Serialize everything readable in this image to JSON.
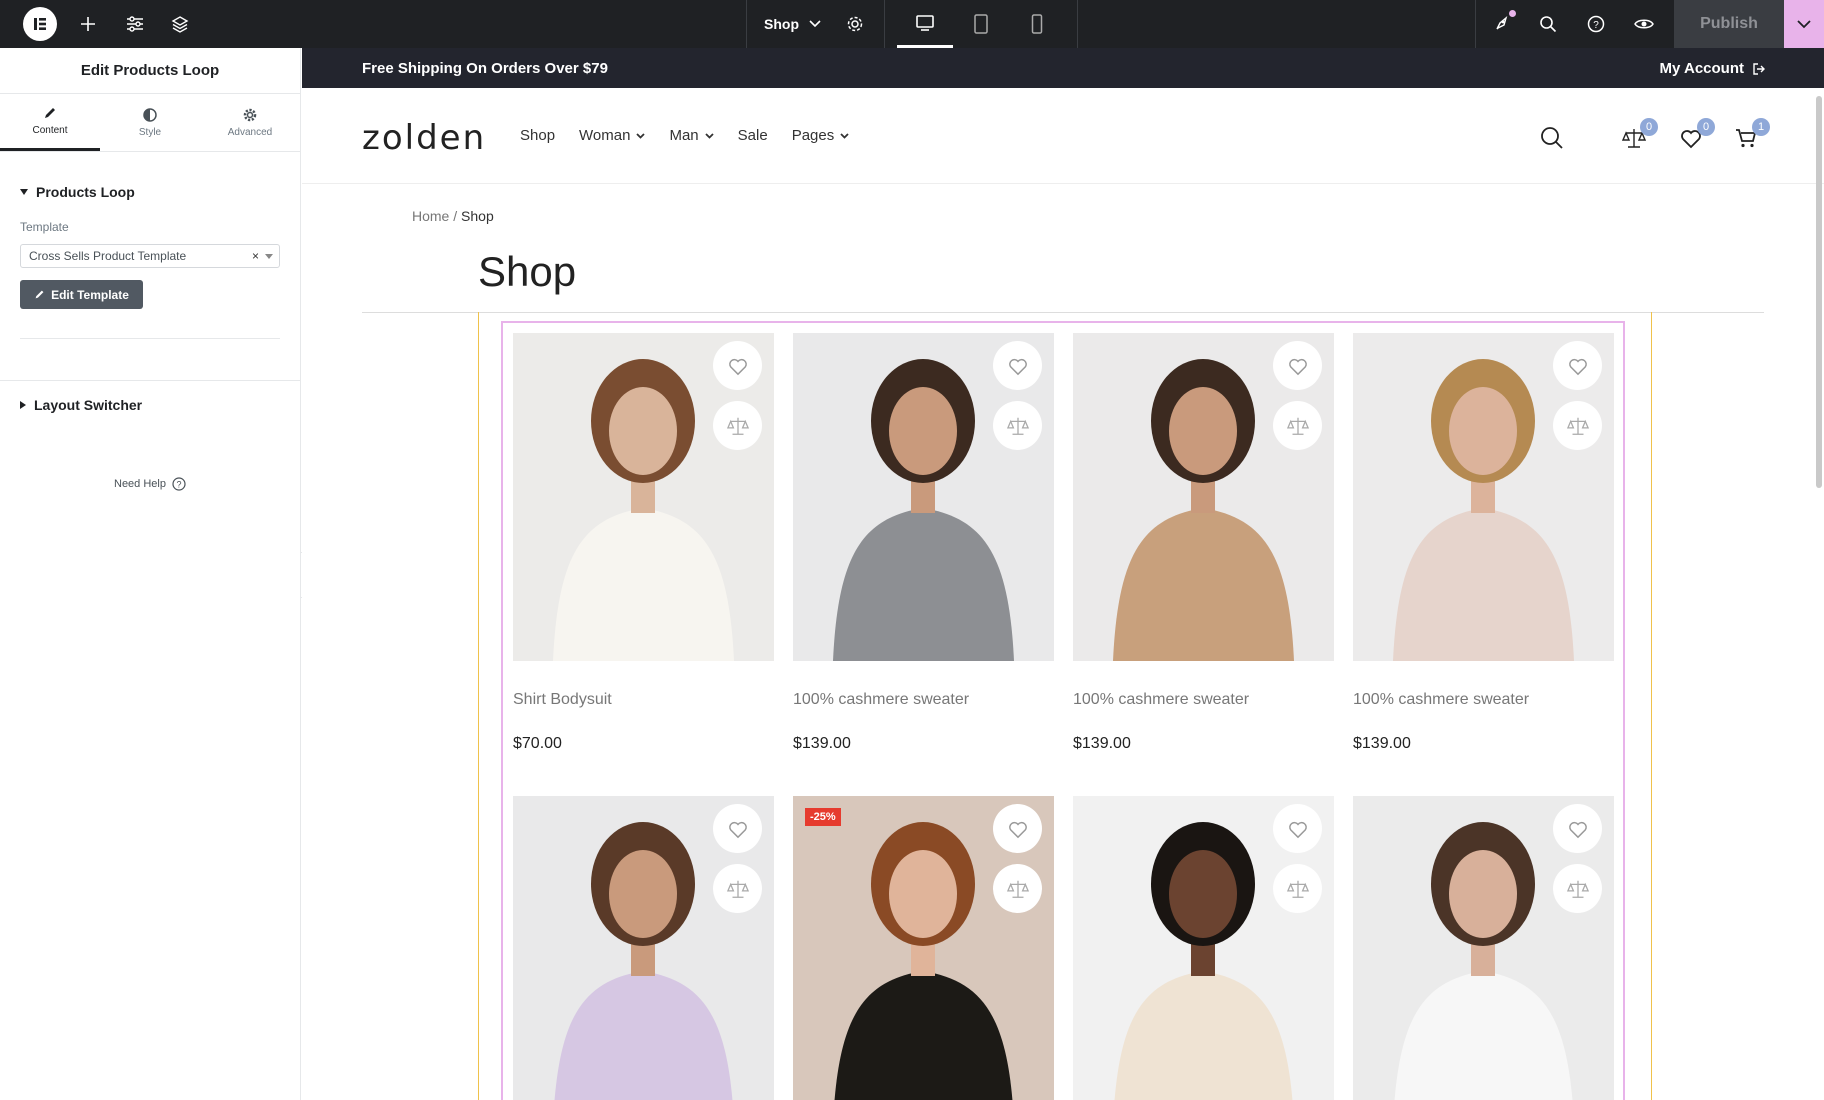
{
  "topbar": {
    "page_name": "Shop",
    "publish_label": "Publish",
    "colors": {
      "bg": "#1f2124",
      "accent": "#e8b3ea"
    }
  },
  "panel": {
    "title": "Edit Products Loop",
    "tabs": [
      {
        "label": "Content",
        "icon": "pencil-icon"
      },
      {
        "label": "Style",
        "icon": "half-circle-icon"
      },
      {
        "label": "Advanced",
        "icon": "gear-icon"
      }
    ],
    "section_products": "Products Loop",
    "template_label": "Template",
    "template_value": "Cross Sells Product Template",
    "edit_template_label": "Edit Template",
    "section_layout": "Layout Switcher",
    "need_help": "Need Help"
  },
  "site": {
    "promo_left": "Free Shipping On Orders Over $79",
    "promo_right": "My Account",
    "logo": "zolden",
    "nav": [
      {
        "label": "Shop",
        "dropdown": false
      },
      {
        "label": "Woman",
        "dropdown": true
      },
      {
        "label": "Man",
        "dropdown": true
      },
      {
        "label": "Sale",
        "dropdown": false
      },
      {
        "label": "Pages",
        "dropdown": true
      }
    ],
    "compare_count": "0",
    "wishlist_count": "0",
    "cart_count": "1",
    "breadcrumb_home": "Home",
    "breadcrumb_sep": "/",
    "breadcrumb_current": "Shop",
    "page_title": "Shop"
  },
  "products": [
    {
      "name": "Shirt Bodysuit",
      "price": "$70.00",
      "bg": "#ecebe9",
      "top": "#f7f5f0",
      "skin": "#d9b49a",
      "hair": "#7a4d31"
    },
    {
      "name": "100% cashmere sweater",
      "price": "$139.00",
      "bg": "#e9e9ea",
      "top": "#8d8f93",
      "skin": "#c99a7c",
      "hair": "#3c2a20"
    },
    {
      "name": "100% cashmere sweater",
      "price": "$139.00",
      "bg": "#ebeaea",
      "top": "#c8a07c",
      "skin": "#c99a7c",
      "hair": "#3c2a20"
    },
    {
      "name": "100% cashmere sweater",
      "price": "$139.00",
      "bg": "#ecebeb",
      "top": "#e6d4cc",
      "skin": "#dcb39b",
      "hair": "#b58a52"
    },
    {
      "name": "",
      "price": "",
      "bg": "#e9e9ea",
      "top": "#d6c7e3",
      "skin": "#c99a7c",
      "hair": "#5a3a28"
    },
    {
      "name": "",
      "price": "",
      "bg": "#d8c7bb",
      "top": "#1c1a16",
      "skin": "#e0b49a",
      "hair": "#8a4a25",
      "sale": "-25%"
    },
    {
      "name": "",
      "price": "",
      "bg": "#f1f1f1",
      "top": "#efe3d3",
      "skin": "#6b4330",
      "hair": "#1a1512"
    },
    {
      "name": "",
      "price": "",
      "bg": "#ebebeb",
      "top": "#f7f7f7",
      "skin": "#d8b09a",
      "hair": "#4b3427"
    }
  ]
}
